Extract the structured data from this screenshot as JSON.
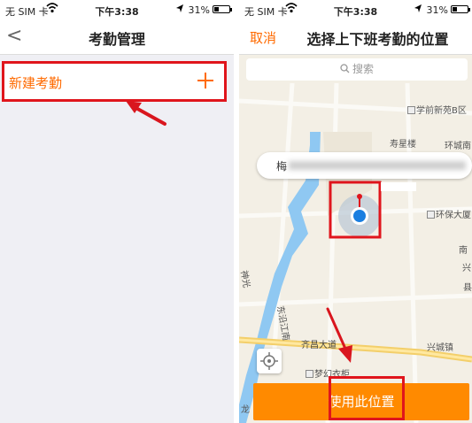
{
  "left_screen": {
    "status_bar": {
      "carrier": "无 SIM 卡",
      "time": "下午3:38",
      "battery": "31%",
      "battery_level": 0.31
    },
    "nav": {
      "back_glyph": "<",
      "title": "考勤管理"
    },
    "new_row": {
      "label": "新建考勤",
      "plus_glyph": "+"
    }
  },
  "right_screen": {
    "status_bar": {
      "carrier": "无 SIM 卡",
      "time": "下午3:38",
      "battery": "31%",
      "battery_level": 0.31
    },
    "nav": {
      "cancel_label": "取消",
      "title": "选择上下班考勤的位置"
    },
    "search": {
      "placeholder": "搜索"
    },
    "address": {
      "prefix": "梅"
    },
    "map_labels": [
      "学前新苑B区",
      "寿星楼",
      "环城南",
      "环保大厦",
      "东沿江南",
      "兴城镇",
      "齐昌大道",
      "梦幻衣柜",
      "神光",
      "南",
      "兴",
      "县",
      "龙"
    ],
    "use_button": {
      "label": "使用此位置"
    }
  },
  "colors": {
    "accent": "#ff6a00",
    "button": "#ff8a00",
    "highlight": "#e0151c",
    "water": "#8fc8f2",
    "arrow": "#d9161e"
  },
  "icons": [
    "back-chevron-icon",
    "plus-icon",
    "search-icon",
    "location-pin-icon",
    "locate-icon",
    "location-arrow-icon",
    "wifi-icon",
    "battery-icon"
  ]
}
